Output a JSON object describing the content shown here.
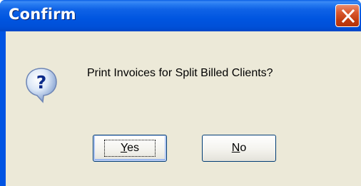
{
  "window": {
    "title": "Confirm"
  },
  "dialog": {
    "icon": "question-icon",
    "message": "Print Invoices for Split Billed Clients?"
  },
  "buttons": {
    "yes": {
      "mnemonic": "Y",
      "rest": "es"
    },
    "no": {
      "mnemonic": "N",
      "rest": "o"
    }
  },
  "colors": {
    "titlebar": "#0054e3",
    "client_background": "#ece9d8",
    "close_button": "#c23d10",
    "button_border": "#003c74"
  }
}
